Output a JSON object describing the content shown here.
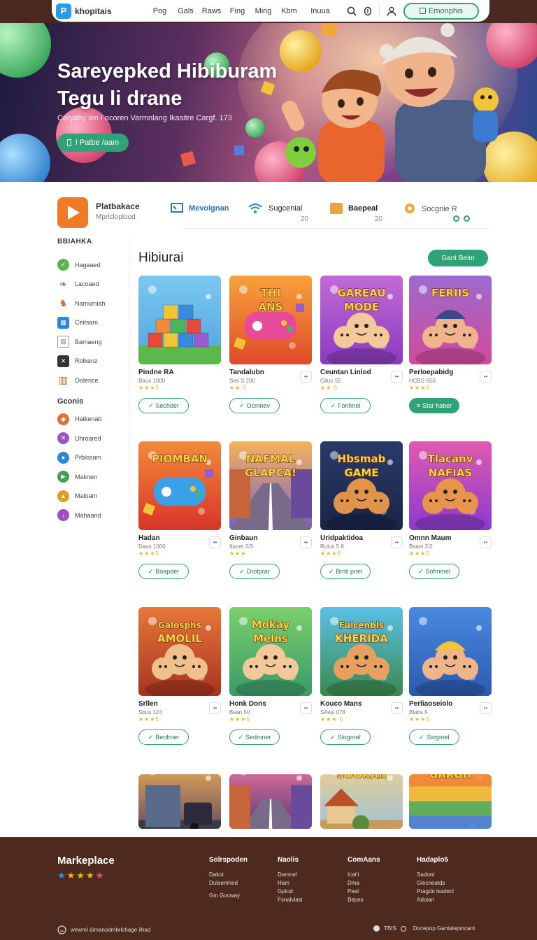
{
  "header": {
    "logo_text": "khopitais",
    "menu": [
      "Pog",
      "Gals",
      "Raws",
      "Fing",
      "Ming",
      "Kbm",
      "Inuua"
    ],
    "cta_label": "Emonphis"
  },
  "hero": {
    "title_line1": "Sareyepked Hibiburam",
    "title_line2": "Tegu li drane",
    "subtitle": "Caryaby sm I ocoren Varmnlang Ikasitre Cargf. 173",
    "cta_label": "I Patbe /aam"
  },
  "features": {
    "app_title": "Platbakace",
    "app_sub": "Mprlcloplood",
    "items": [
      {
        "label": "Mevolgnan",
        "count": ""
      },
      {
        "label": "Sugcenial",
        "count": "20"
      },
      {
        "label": "Baepeal",
        "count": "20"
      },
      {
        "label": "Socgnie R",
        "count": ""
      }
    ]
  },
  "sidebar": {
    "section1_title": "BBIAHKA",
    "section1": [
      {
        "label": "Hagaaed",
        "icon": "check-icon",
        "color": "#5bb54a"
      },
      {
        "label": "Lacoaed",
        "icon": "leaf-icon",
        "color": "#4fa34a"
      },
      {
        "label": "Namumiah",
        "icon": "horse-icon",
        "color": "#d2702a"
      },
      {
        "label": "Ceitsam",
        "icon": "grid-icon",
        "color": "#2b87d8"
      },
      {
        "label": "Bamaeng",
        "icon": "table-icon",
        "color": "#777777"
      },
      {
        "label": "Rolkenz",
        "icon": "x-icon",
        "color": "#333333"
      },
      {
        "label": "Oolence",
        "icon": "books-icon",
        "color": "#d96b2a"
      }
    ],
    "section2_title": "Gconis",
    "section2": [
      {
        "label": "Hatkenab",
        "icon": "diamond-icon",
        "color": "#e0703a"
      },
      {
        "label": "Uhroared",
        "icon": "cross-icon",
        "color": "#9b52c9"
      },
      {
        "label": "Prblosam",
        "icon": "drop-icon",
        "color": "#2b87d8"
      },
      {
        "label": "Maknen",
        "icon": "play-icon",
        "color": "#3ea34a"
      },
      {
        "label": "Maloam",
        "icon": "triangle-icon",
        "color": "#e39b22"
      },
      {
        "label": "Mahaand",
        "icon": "down-icon",
        "color": "#9b4fc2"
      }
    ]
  },
  "main": {
    "title": "Hibiurai",
    "action_label": "Gant Beim",
    "cards": [
      {
        "title": "Pindne RA",
        "meta": "Baus 1000",
        "stars": "★★★5",
        "button": "Sechder",
        "art": "blocks"
      },
      {
        "title": "Tandalubn",
        "meta": "Ses S 200",
        "stars": "★★ 5",
        "button": "Ocmnev",
        "art": "controller"
      },
      {
        "title": "Ceuntan Linlod",
        "meta": "Gilus S5",
        "stars": "★★ 5",
        "button": "Fonfmel",
        "art": "pets"
      },
      {
        "title": "Perloepabidg",
        "meta": "HCBS 650",
        "stars": "★★★5",
        "button": "Star haber",
        "art": "boy"
      },
      {
        "title": "Hadan",
        "meta": "Daus 1000",
        "stars": "★★★5",
        "button": "Boapder",
        "art": "gamepad"
      },
      {
        "title": "Ginbaun",
        "meta": "Iburet 2/3",
        "stars": "★★★",
        "button": "Drotprar",
        "art": "street"
      },
      {
        "title": "Uridpaktidoa",
        "meta": "Rolus 5 8",
        "stars": "★★★8",
        "button": "Bmti pnei",
        "art": "bears"
      },
      {
        "title": "Omnn Maum",
        "meta": "Bsam 2/2",
        "stars": "★★★5",
        "button": "Sofmmel",
        "art": "tigers"
      },
      {
        "title": "Srllen",
        "meta": "Sbus 124",
        "stars": "★★★5",
        "button": "Beofmer",
        "art": "family"
      },
      {
        "title": "Honk Dons",
        "meta": "Bsan 50",
        "stars": "★★★5",
        "button": "Sedmner",
        "art": "kids"
      },
      {
        "title": "Kouco Mans",
        "meta": "SAws 078",
        "stars": "★★★ 5",
        "button": "Slogrnel",
        "art": "animals"
      },
      {
        "title": "Perliaoseiolo",
        "meta": "Blabs 5",
        "stars": "★★★5",
        "button": "Siogmel",
        "art": "builder"
      },
      {
        "title": "",
        "meta": "",
        "stars": "",
        "button": "",
        "art": "truck"
      },
      {
        "title": "",
        "meta": "",
        "stars": "",
        "button": "",
        "art": "tunnel"
      },
      {
        "title": "",
        "meta": "",
        "stars": "",
        "button": "",
        "art": "village"
      },
      {
        "title": "",
        "meta": "",
        "stars": "",
        "button": "",
        "art": "rainbow"
      }
    ],
    "thumb_texts": [
      "",
      "THI ANS",
      "GAREAU MODE",
      "FERIIS",
      "PIOMBAN",
      "NAFMAL GLAPCA!",
      "Hbsmab GAME",
      "Tlacanv NAFIAS",
      "Galosphs AMOLIL",
      "Mokay Melns",
      "Fulcenbls KHERIDA",
      "",
      "",
      "",
      "SOOKAII",
      "GARGH"
    ]
  },
  "footer": {
    "brand": "Markeplace",
    "col1_title": "Solrspoden",
    "col1": [
      "Dakot",
      "Duloemhed",
      "",
      "Gm Gocway"
    ],
    "col2_title": "Naolis",
    "col2": [
      "Damnel",
      "Ham",
      "Gptod",
      "Fsnalvlasi"
    ],
    "col3_title": "ComAans",
    "col3": [
      "Icat't",
      "Dma",
      "Peal",
      "Bepes"
    ],
    "col4_title": "Hadaplo5",
    "col4": [
      "Sadont",
      "Glecneatds",
      "Pragdn lsadecl",
      "Adoian"
    ],
    "copyright": "wewrel dimanodmbrlchage ilhad",
    "bottom_right_a": "TBIS",
    "bottom_right_b": "Docepop Gantalepmcant"
  }
}
